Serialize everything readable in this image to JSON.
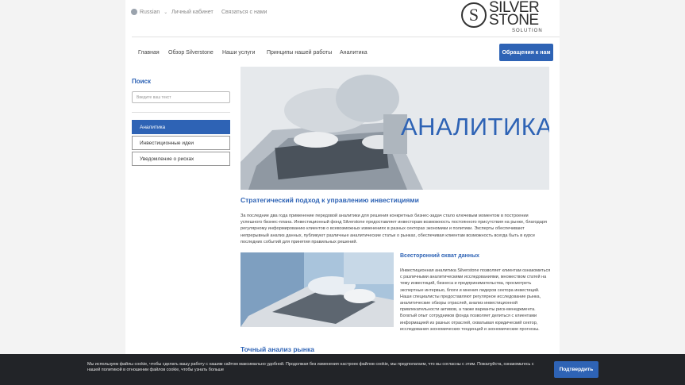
{
  "topbar": {
    "language": "Russian",
    "links": [
      "Личный кабинет",
      "Связаться с нами"
    ]
  },
  "logo": {
    "letter": "S",
    "line1": "SILVER",
    "line2": "STONE",
    "sub": "SOLUTION"
  },
  "nav": {
    "items": [
      "Главная",
      "Обзор Silverstone",
      "Наши услуги",
      "Принципы нашей работы",
      "Аналитика"
    ],
    "contact_button": "Обращения к нам"
  },
  "sidebar": {
    "title": "Поиск",
    "search_placeholder": "Введите ваш текст",
    "items": [
      "Аналитика",
      "Инвестиционные идеи",
      "Уведомление о рисках"
    ]
  },
  "hero": {
    "title": "АНАЛИТИКА"
  },
  "content": {
    "section1_title": "Стратегический подход к управлению инвестициями",
    "section1_text": "За последние два года применение передовой аналитики для решения конкретных бизнес-задач стало ключевым моментом в построении успешного бизнес-плана. Инвестиционный фонд Silverstone предоставляет инвесторам возможность постоянного присутствия на рынке, благодаря регулярному информированию клиентов о всевозможных изменениях в разных секторах экономики и политики. Эксперты обеспечивают непрерывный анализ данных, публикуют различные аналитические статьи о рынках, обеспечивая клиентам возможность всегда быть в курсе последних событий для принятия правильных решений.",
    "section2_title": "Всесторонний охват данных",
    "section2_text": "Инвестиционная аналитика Silverstone позволяет клиентам ознакомиться с различными аналитическими исследованиями, множеством статей на тему инвестиций, бизнеса и предпринимательства, просмотреть экспертные интервью, блоги и мнения лидеров сектора инвестиций. Наши специалисты предоставляют регулярное исследование рынка, аналитические обзоры отраслей, анализ инвестиционной привлекательности активов, а также варианты риск-менеджмента. Богатый опыт сотрудников фонда позволяет делиться с клиентами информацией из разных отраслей, охватывая юридический сектор, исследования экономических тенденций и экономические прогнозы.",
    "section3_title": "Точный анализ рынка"
  },
  "cookie": {
    "text": "Мы используем файлы cookie, чтобы сделать вашу работу с нашим сайтом максимально удобной. Продолжая без изменения настроек файлов cookie, мы предполагаем, что вы согласны с этим. Пожалуйста, ознакомьтесь с нашей политикой в отношении файлов cookie, чтобы узнать больше",
    "button": "Подтвердить"
  },
  "colors": {
    "accent": "#2e63b5",
    "cookie_bg": "#222428",
    "page_bg": "#f3f3f3"
  }
}
